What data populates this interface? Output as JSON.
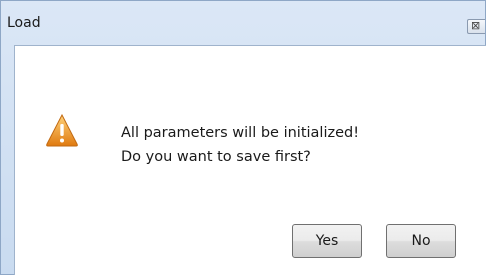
{
  "window": {
    "title": "Load",
    "close_symbol": "⊠"
  },
  "message": {
    "line1": "All parameters will be initialized!",
    "line2": "Do you want to save first?",
    "icon": "warning-icon"
  },
  "buttons": {
    "yes_label": "Yes",
    "no_label": "No"
  },
  "colors": {
    "frame": "#c9dbf0",
    "warning": "#f0a020"
  }
}
